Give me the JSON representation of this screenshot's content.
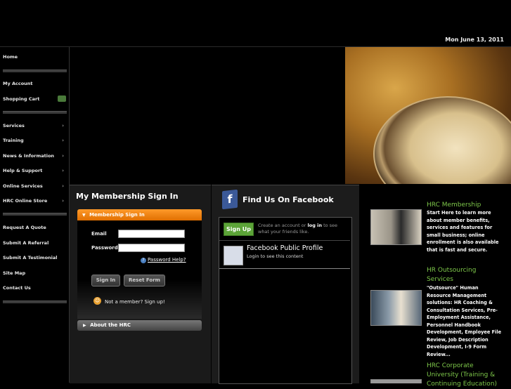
{
  "header": {
    "date": "Mon June 13, 2011"
  },
  "sidebar": {
    "items": [
      {
        "label": "Home",
        "arrow": false
      },
      {
        "label": "My Account",
        "arrow": false
      },
      {
        "label": "Shopping Cart",
        "arrow": false
      },
      {
        "label": "Services",
        "arrow": true
      },
      {
        "label": "Training",
        "arrow": true
      },
      {
        "label": "News & Information",
        "arrow": true
      },
      {
        "label": "Help & Support",
        "arrow": true
      },
      {
        "label": "Online Services",
        "arrow": true
      },
      {
        "label": "HRC Online Store",
        "arrow": true
      },
      {
        "label": "Request A Quote",
        "arrow": false
      },
      {
        "label": "Submit A Referral",
        "arrow": false
      },
      {
        "label": "Submit A Testimonial",
        "arrow": false
      },
      {
        "label": "Site Map",
        "arrow": false
      },
      {
        "label": "Contact Us",
        "arrow": false
      }
    ],
    "arrow_glyph": "›"
  },
  "signin": {
    "title": "My Membership Sign In",
    "tab_label": "Membership Sign In",
    "email_label": "Email",
    "email_value": "",
    "password_label": "Password",
    "password_value": "",
    "help_link": "Password Help?",
    "sign_in_button": "Sign In",
    "reset_button": "Reset Form",
    "not_member": "Not a member? Sign up!",
    "about_label": "About the HRC"
  },
  "facebook": {
    "title": "Find Us On Facebook",
    "signup_button": "Sign Up",
    "signup_text_before": "Create an account or",
    "signup_link": "log in",
    "signup_text_after": "to see what your friends like.",
    "profile_title": "Facebook Public Profile",
    "profile_sub": "Login to see this content"
  },
  "hrc": {
    "items": [
      {
        "title": "HRC Membership",
        "desc": "Start Here to learn more about member benefits, services and features for small business; online enrollment is also available that is fast and secure."
      },
      {
        "title": "HR Outsourcing Services",
        "desc": "\"Outsource\" Human Resource Management solutions: HR Coaching & Consultation Services, Pre-Employment Assistance, Personnel Handbook Development, Employee File Review, Job Description Development, I-9 Form Review..."
      },
      {
        "title": "HRC Corporate University (Training & Continuing Education)",
        "desc": ""
      }
    ]
  },
  "colors": {
    "accent_orange": "#f58a10",
    "link_green": "#7ec84a",
    "facebook_blue": "#3b5998"
  }
}
